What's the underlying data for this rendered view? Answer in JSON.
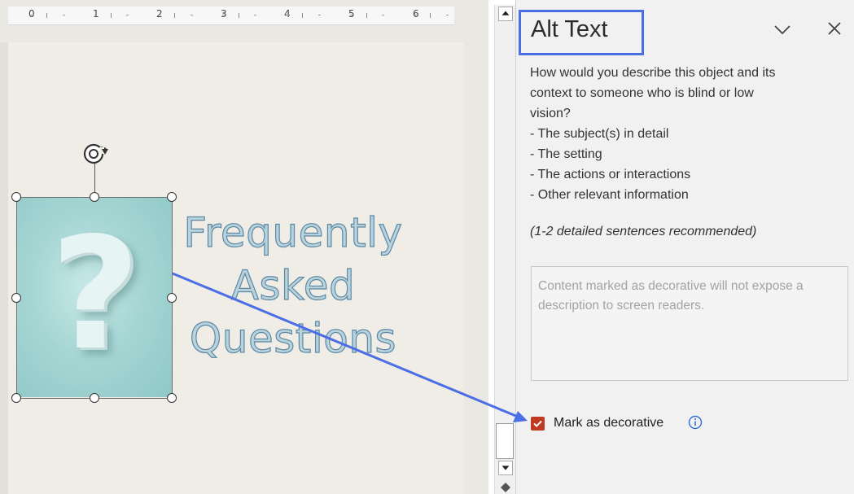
{
  "ruler": {
    "labels": [
      "0",
      "1",
      "2",
      "3",
      "4",
      "5",
      "6"
    ]
  },
  "slide": {
    "title_lines": [
      "Frequently",
      "Asked",
      "Questions"
    ],
    "picture_glyph": "?"
  },
  "pane": {
    "title": "Alt Text",
    "instructions": [
      "How would you describe this object and its",
      "context to someone who is blind or low",
      "vision?",
      "- The subject(s) in detail",
      "- The setting",
      "- The actions or interactions",
      "- Other relevant information"
    ],
    "recommendation": "(1-2 detailed sentences recommended)",
    "input_placeholder": "Content marked as decorative will not expose a description to screen readers.",
    "decorative_label": "Mark as decorative",
    "decorative_checked": true
  },
  "colors": {
    "highlight_box": "#4b6ee6",
    "arrow": "#4b6ee6",
    "checkbox": "#bf3a20",
    "info_icon": "#2f6fd6"
  },
  "icons": {
    "rotate": "rotate-icon",
    "collapse": "chevron-down-icon",
    "close": "close-icon",
    "info": "info-icon",
    "check": "check-icon"
  }
}
